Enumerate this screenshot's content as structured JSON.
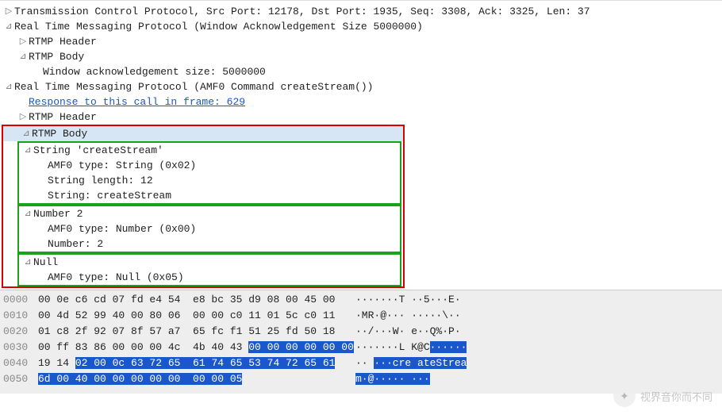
{
  "details": {
    "tcp": "Transmission Control Protocol, Src Port: 12178, Dst Port: 1935, Seq: 3308, Ack: 3325, Len: 37",
    "rtmp_win": {
      "title": "Real Time Messaging Protocol (Window Acknowledgement Size 5000000)",
      "header": "RTMP Header",
      "body": "RTMP Body",
      "wack": "Window acknowledgement size: 5000000"
    },
    "rtmp_cmd": {
      "title": "Real Time Messaging Protocol (AMF0 Command createStream())",
      "response_link": "Response to this call in frame: 629",
      "header": "RTMP Header",
      "body": {
        "title": "RTMP Body",
        "string_node": {
          "title": "String 'createStream'",
          "amf_type": "AMF0 type: String (0x02)",
          "length": "String length: 12",
          "value": "String: createStream"
        },
        "number_node": {
          "title": "Number 2",
          "amf_type": "AMF0 type: Number (0x00)",
          "value": "Number: 2"
        },
        "null_node": {
          "title": "Null",
          "amf_type": "AMF0 type: Null (0x05)"
        }
      }
    }
  },
  "hex": {
    "rows": [
      {
        "off": "0000",
        "bytes": "00 0e c6 cd 07 fd e4 54  e8 bc 35 d9 08 00 45 00",
        "ascii": "·······T ··5···E·"
      },
      {
        "off": "0010",
        "bytes": "00 4d 52 99 40 00 80 06  00 00 c0 11 01 5c c0 11",
        "ascii": "·MR·@··· ·····\\··"
      },
      {
        "off": "0020",
        "bytes": "01 c8 2f 92 07 8f 57 a7  65 fc f1 51 25 fd 50 18",
        "ascii": "··/···W· e··Q%·P·"
      },
      {
        "off": "0030",
        "bytes": "00 ff 83 86 00 00 00 4c  4b 40 43 ",
        "ascii": "·······L K@C"
      },
      {
        "off": "0040",
        "bytes": "19 14 ",
        "ascii": "·· "
      },
      {
        "off": "0050",
        "bytes": "",
        "ascii": ""
      }
    ],
    "sel_30_b": "00 00 00 00 00 00",
    "sel_30_a": "······",
    "sel_40_b": "02 00 0c 63 72 65  61 74 65 53 74 72 65 61",
    "sel_40_a": "···cre ateStrea",
    "sel_50_b": "6d 00 40 00 00 00 00 00  00 00 05",
    "sel_50_a": "m·@····· ···"
  },
  "watermark": "视界音你而不同"
}
